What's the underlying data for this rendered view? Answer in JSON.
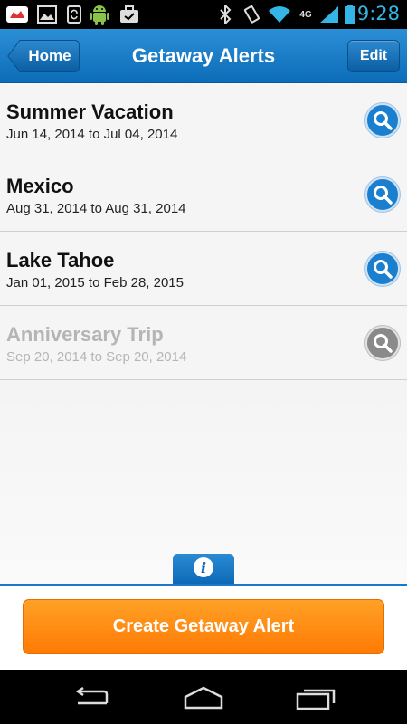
{
  "status_bar": {
    "time": "9:28",
    "network": "4G",
    "icons": [
      "notification-icon",
      "image-icon",
      "sync-icon",
      "android-icon",
      "briefcase-check-icon",
      "bluetooth-icon",
      "vibrate-icon",
      "wifi-icon",
      "signal-icon",
      "battery-icon"
    ],
    "time_color": "#33b5e5"
  },
  "header": {
    "title": "Getaway Alerts",
    "home_label": "Home",
    "edit_label": "Edit",
    "color": "#1a78c6"
  },
  "alerts": [
    {
      "name": "Summer Vacation",
      "dates": "Jun 14, 2014 to Jul 04, 2014",
      "active": true
    },
    {
      "name": "Mexico",
      "dates": "Aug 31, 2014 to Aug 31, 2014",
      "active": true
    },
    {
      "name": "Lake Tahoe",
      "dates": "Jan 01, 2015 to Feb 28, 2015",
      "active": true
    },
    {
      "name": "Anniversary Trip",
      "dates": "Sep 20, 2014 to Sep 20, 2014",
      "active": false
    }
  ],
  "info_icon": "info-icon",
  "footer": {
    "create_label": "Create Getaway Alert",
    "accent": "#ff8a10"
  },
  "nav_bar": {
    "icons": [
      "back-icon",
      "home-icon",
      "recent-apps-icon"
    ]
  }
}
